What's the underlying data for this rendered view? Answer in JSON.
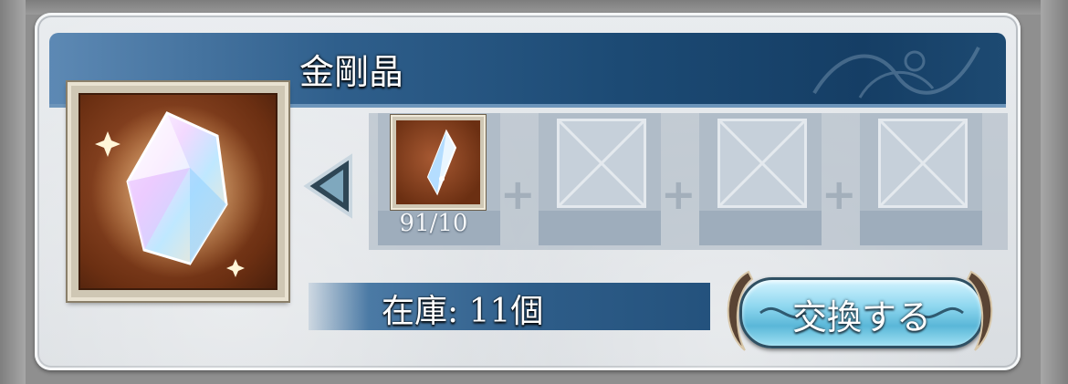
{
  "item": {
    "name": "金剛晶"
  },
  "materials": [
    {
      "icon": "crystal-shard-icon",
      "count": "91/10"
    },
    {
      "icon": "empty-slot-icon"
    },
    {
      "icon": "empty-slot-icon"
    },
    {
      "icon": "empty-slot-icon"
    }
  ],
  "stock": {
    "label": "在庫: 11個"
  },
  "exchange": {
    "label": "交換する"
  },
  "colors": {
    "title_bar": "#1c4a74",
    "button": "#8fd7ef",
    "panel": "#e4e8ec"
  }
}
